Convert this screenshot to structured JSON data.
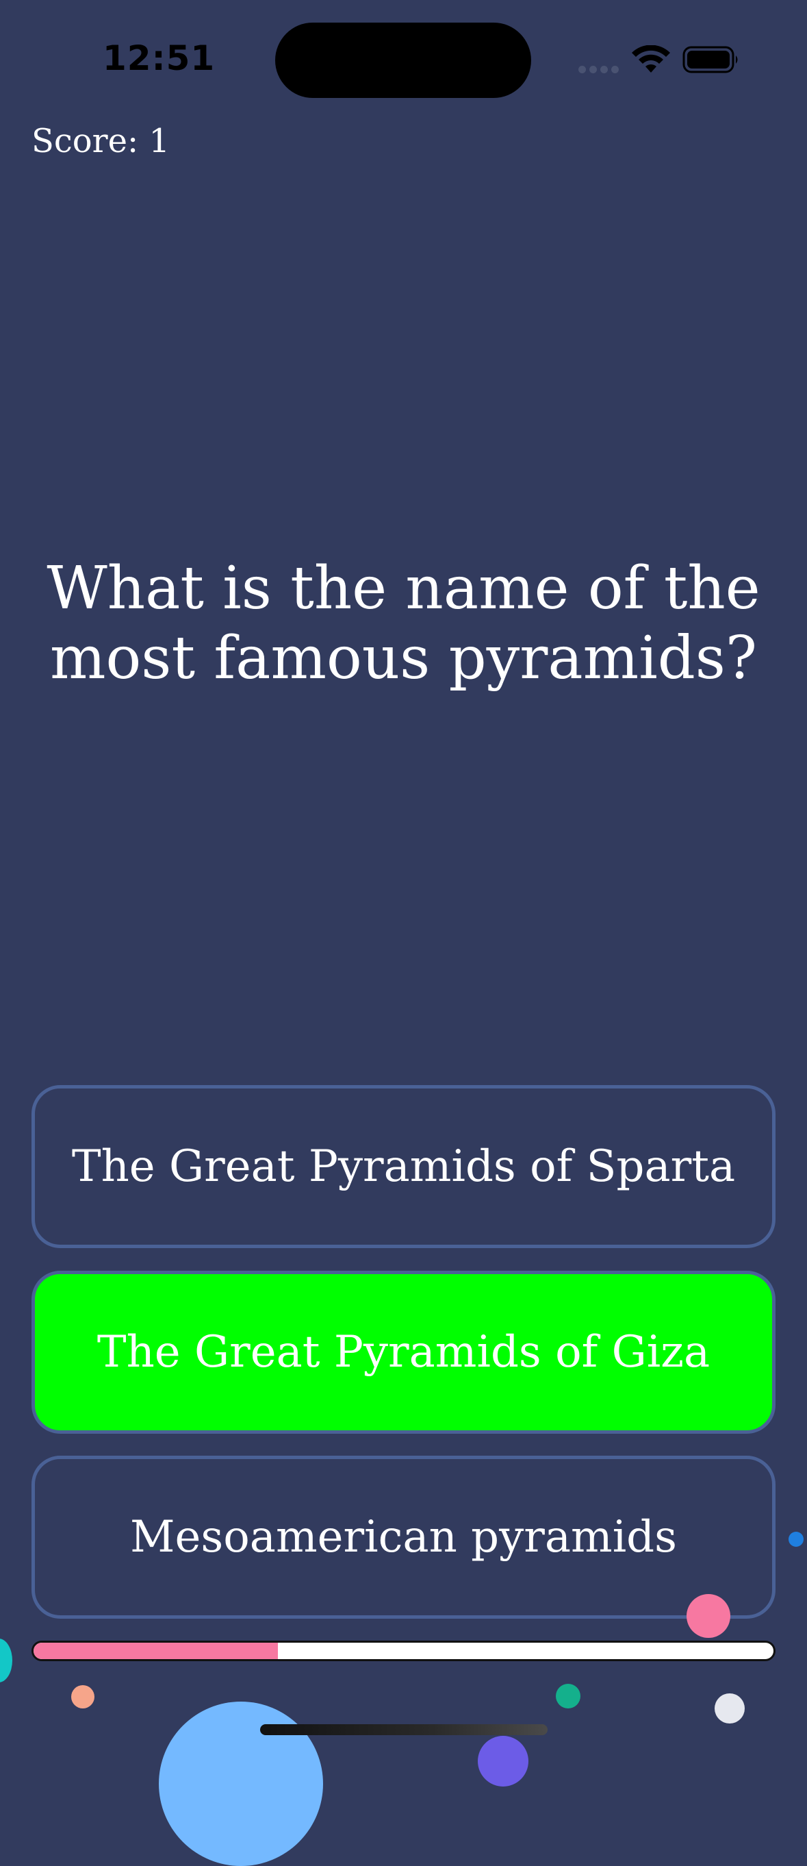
{
  "status_bar": {
    "time": "12:51"
  },
  "quiz": {
    "score_text": "Score: 1",
    "question": "What is the name of the most famous pyramids?",
    "answers": [
      {
        "label": "The Great Pyramids of Sparta",
        "state": "default"
      },
      {
        "label": "The Great Pyramids of Giza",
        "state": "correct"
      },
      {
        "label": "Mesoamerican pyramids",
        "state": "default"
      }
    ],
    "progress": 0.33
  },
  "colors": {
    "background": "#323b5e",
    "answer_border": "#4a6196",
    "correct_answer": "#00ff00",
    "progress_fill": "#f778a1",
    "progress_track": "#ffffff"
  },
  "icons": {
    "signal": "cellular-signal-icon",
    "wifi": "wifi-icon",
    "battery": "battery-icon"
  }
}
